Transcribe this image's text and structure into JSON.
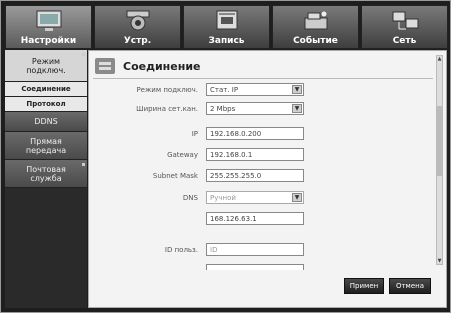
{
  "tabs": [
    {
      "label": "Настройки",
      "icon": "settings-icon",
      "active": true
    },
    {
      "label": "Устр.",
      "icon": "camera-icon",
      "active": false
    },
    {
      "label": "Запись",
      "icon": "rec-icon",
      "active": false
    },
    {
      "label": "Событие",
      "icon": "event-icon",
      "active": false
    },
    {
      "label": "Сеть",
      "icon": "network-icon",
      "active": false
    }
  ],
  "sidebar": {
    "items": [
      {
        "label": "Режим подключ."
      },
      {
        "label": "Соединение"
      },
      {
        "label": "Протокол"
      },
      {
        "label": "DDNS"
      },
      {
        "label": "Прямая передача"
      },
      {
        "label": "Почтовая служба"
      }
    ]
  },
  "panel": {
    "title": "Соединение",
    "fields": {
      "conn_mode_label": "Режим подключ.",
      "conn_mode_value": "Стат. IP",
      "bandwidth_label": "Ширина сет.кан.",
      "bandwidth_value": "2 Mbps",
      "ip_label": "IP",
      "ip_value": "192.168.0.200",
      "gateway_label": "Gateway",
      "gateway_value": "192.168.0.1",
      "subnet_label": "Subnet Mask",
      "subnet_value": "255.255.255.0",
      "dns_label": "DNS",
      "dns_mode_value": "Ручной",
      "dns_value": "168.126.63.1",
      "id_label": "ID польз.",
      "id_placeholder": "ID"
    },
    "buttons": {
      "apply": "Примен",
      "cancel": "Отмена"
    }
  }
}
